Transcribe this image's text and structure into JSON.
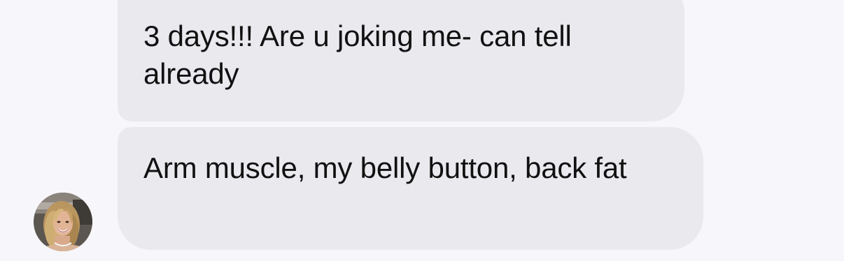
{
  "thread": {
    "messages": [
      {
        "text": "3 days!!! Are u joking me- can tell already",
        "sender": "received"
      },
      {
        "text": "Arm muscle, my belly button, back fat",
        "sender": "received"
      }
    ]
  },
  "avatar": {
    "icon": "contact-photo-avatar"
  },
  "colors": {
    "background": "#f7f6fa",
    "bubble": "#e9e9ee",
    "text": "#111111"
  }
}
